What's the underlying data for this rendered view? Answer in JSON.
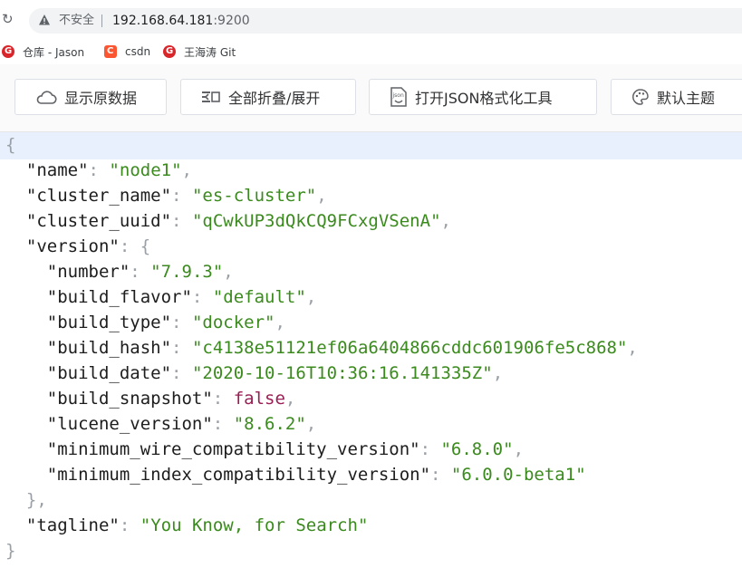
{
  "browser": {
    "insecure_label": "不安全",
    "url_host": "192.168.64.181",
    "url_port": ":9200"
  },
  "bookmarks": [
    {
      "label": "仓库 - Jason",
      "icon": "gitee-icon"
    },
    {
      "label": "csdn",
      "icon": "csdn-icon"
    },
    {
      "label": "王海涛 Git",
      "icon": "gitee-icon"
    }
  ],
  "toolbar": {
    "raw": "显示原数据",
    "fold": "全部折叠/展开",
    "json_tool": "打开JSON格式化工具",
    "theme": "默认主题"
  },
  "json": {
    "name": "node1",
    "cluster_name": "es-cluster",
    "cluster_uuid": "qCwkUP3dQkCQ9FCxgVSenA",
    "version": {
      "number": "7.9.3",
      "build_flavor": "default",
      "build_type": "docker",
      "build_hash": "c4138e51121ef06a6404866cddc601906fe5c868",
      "build_date": "2020-10-16T10:36:16.141335Z",
      "build_snapshot": "false",
      "lucene_version": "8.6.2",
      "minimum_wire_compatibility_version": "6.8.0",
      "minimum_index_compatibility_version": "6.0.0-beta1"
    },
    "tagline": "You Know, for Search"
  }
}
